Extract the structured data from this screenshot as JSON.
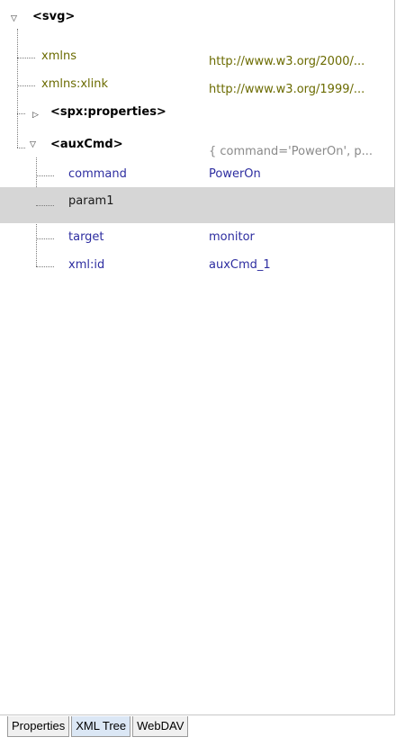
{
  "tree": {
    "root": {
      "tag": "<svg>"
    },
    "svg_children": [
      {
        "name": "xmlns",
        "value": "http://www.w3.org/2000/..."
      },
      {
        "name": "xmlns:xlink",
        "value": "http://www.w3.org/1999/..."
      }
    ],
    "spx_properties": {
      "tag": "<spx:properties>"
    },
    "auxCmd": {
      "tag": "<auxCmd>",
      "summary": "{ command='PowerOn', p...",
      "attributes": [
        {
          "name": "command",
          "value": "PowerOn"
        },
        {
          "name": "param1",
          "value": ""
        },
        {
          "name": "target",
          "value": "monitor"
        },
        {
          "name": "xml:id",
          "value": "auxCmd_1"
        }
      ]
    }
  },
  "tabs": [
    {
      "label": "Properties",
      "active": false
    },
    {
      "label": "XML Tree",
      "active": true
    },
    {
      "label": "WebDAV",
      "active": false
    }
  ]
}
